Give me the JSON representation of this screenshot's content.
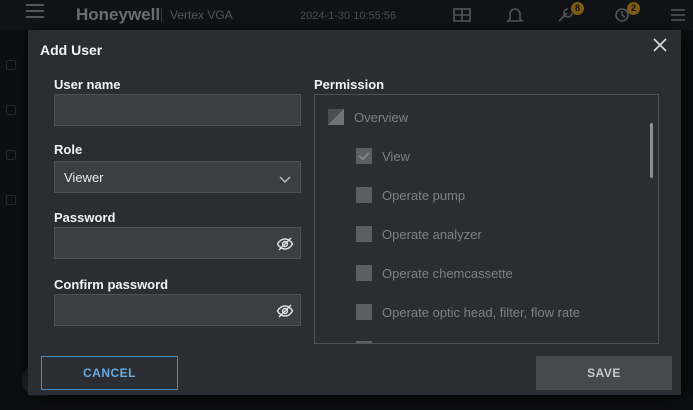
{
  "background_app": {
    "brand": "Honeywell",
    "product": "Vertex VGA",
    "time": "2024-1-30 10:55:56",
    "status_icons": [
      {
        "icon": "grid-status-icon",
        "badge": ""
      },
      {
        "icon": "bell-icon",
        "badge": ""
      },
      {
        "icon": "wrench-status-icon",
        "badge": "8"
      },
      {
        "icon": "maintenance-status-icon",
        "badge": "2"
      },
      {
        "icon": "list-status-icon",
        "badge": ""
      }
    ]
  },
  "dialog": {
    "title": "Add User",
    "close_icon": "close-icon",
    "username": {
      "label": "User name",
      "value": ""
    },
    "role": {
      "label": "Role",
      "value": "Viewer",
      "icon": "chevron-down-icon"
    },
    "password": {
      "label": "Password",
      "value": "",
      "icon": "eye-slash-icon"
    },
    "confirm_password": {
      "label": "Confirm password",
      "value": "",
      "icon": "eye-slash-icon"
    },
    "permission": {
      "label": "Permission",
      "items": [
        {
          "label": "Overview",
          "level": 0,
          "state": "partial"
        },
        {
          "label": "View",
          "level": 1,
          "state": "checked"
        },
        {
          "label": "Operate pump",
          "level": 1,
          "state": "unchecked"
        },
        {
          "label": "Operate analyzer",
          "level": 1,
          "state": "unchecked"
        },
        {
          "label": "Operate chemcassette",
          "level": 1,
          "state": "unchecked"
        },
        {
          "label": "Operate optic head, filter, flow rate",
          "level": 1,
          "state": "unchecked"
        }
      ]
    },
    "cancel_label": "CANCEL",
    "save_label": "SAVE"
  },
  "colors": {
    "dialog_bg": "#2a2e33",
    "field_bg": "#3a3f45",
    "accent": "#4b8ec2",
    "badge": "#e8a623",
    "save_bg": "#454a50"
  }
}
